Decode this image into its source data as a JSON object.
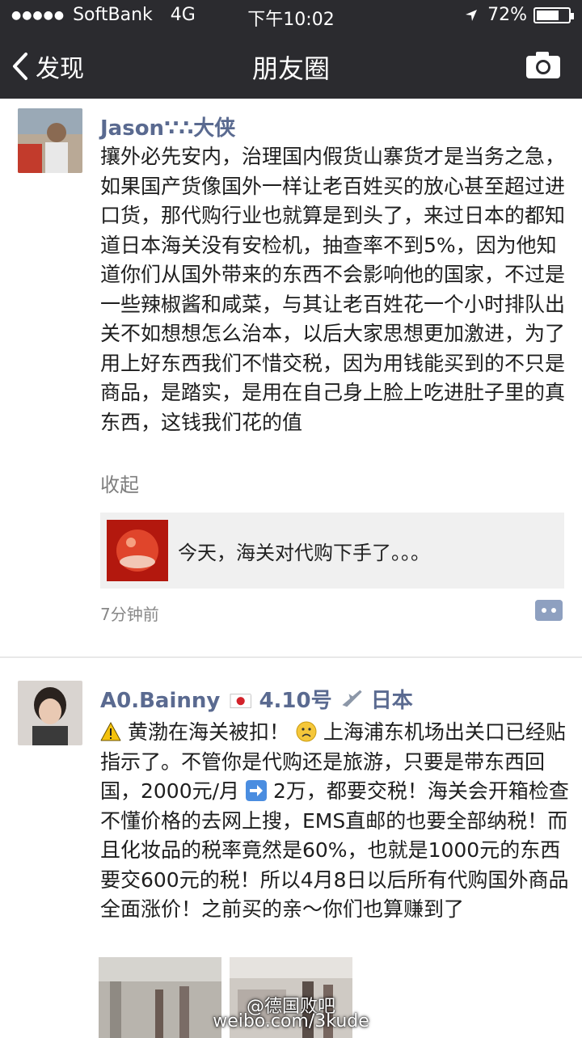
{
  "status": {
    "carrier": "SoftBank",
    "network": "4G",
    "time": "下午10:02",
    "battery": "72%",
    "battery_level": 0.72
  },
  "nav": {
    "back_label": "发现",
    "title": "朋友圈"
  },
  "posts": [
    {
      "name": "Jason∵∴大侠",
      "text": "攘外必先安内，治理国内假货山寨货才是当务之急，如果国产货像国外一样让老百姓买的放心甚至超过进口货，那代购行业也就算是到头了，来过日本的都知道日本海关没有安检机，抽查率不到5%，因为他知道你们从国外带来的东西不会影响他的国家，不过是一些辣椒酱和咸菜，与其让老百姓花一个小时排队出关不如想想怎么治本，以后大家思想更加激进，为了用上好东西我们不惜交税，因为用钱能买到的不只是商品，是踏实，是用在自己身上脸上吃进肚子里的真东西，这钱我们花的值",
      "collapse": "收起",
      "share_text": "今天，海关对代购下手了。。。",
      "time": "7分钟前"
    },
    {
      "name_part1": "A0.Bainny",
      "name_part2": "4.10号",
      "name_part3": "日本",
      "text_part1": "黄渤在海关被扣！",
      "text_part2": "上海浦东机场出关口已经贴指示了。不管你是代购还是旅游，只要是带东西回国，2000元/月",
      "text_part3": "2万，都要交税！海关会开箱检查不懂价格的去网上搜，EMS直邮的也要全部纳税！而且化妆品的税率竟然是60%，也就是1000元的东西要交600元的税！所以4月8日以后所有代购国外商品全面涨价！之前买的亲～你们也算赚到了"
    }
  ],
  "watermark": {
    "line1": "@德国败吧",
    "line2": "weibo.com/3kude"
  }
}
